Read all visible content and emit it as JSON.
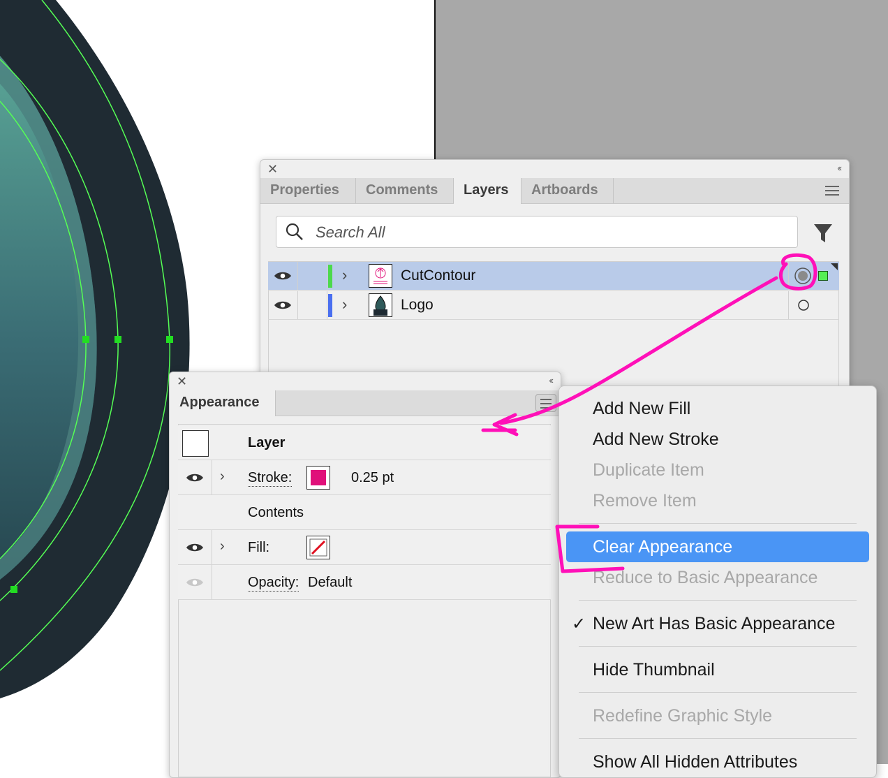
{
  "layers_panel": {
    "tabs": [
      {
        "label": "Properties"
      },
      {
        "label": "Comments"
      },
      {
        "label": "Layers"
      },
      {
        "label": "Artboards"
      }
    ],
    "close_glyph": "✕",
    "collapse_glyph": "‹‹",
    "search_placeholder": "Search All",
    "layers": [
      {
        "name": "CutContour",
        "selected": true,
        "color": "#4cd94c"
      },
      {
        "name": "Logo",
        "selected": false,
        "color": "#4a6ff0"
      }
    ]
  },
  "appearance_panel": {
    "tab": "Appearance",
    "close_glyph": "✕",
    "collapse_glyph": "‹‹",
    "rows": {
      "header": "Layer",
      "stroke_label": "Stroke:",
      "stroke_value": "0.25 pt",
      "contents": "Contents",
      "fill_label": "Fill:",
      "opacity_label": "Opacity:",
      "opacity_value": "Default"
    },
    "stroke_color": "#e0107a"
  },
  "context_menu": {
    "items": [
      {
        "label": "Add New Fill",
        "enabled": true
      },
      {
        "label": "Add New Stroke",
        "enabled": true
      },
      {
        "label": "Duplicate Item",
        "enabled": false
      },
      {
        "label": "Remove Item",
        "enabled": false
      },
      {
        "label": "Clear Appearance",
        "enabled": true,
        "highlighted": true
      },
      {
        "label": "Reduce to Basic Appearance",
        "enabled": false
      },
      {
        "label": "New Art Has Basic Appearance",
        "enabled": true,
        "checked": true
      },
      {
        "label": "Hide Thumbnail",
        "enabled": true
      },
      {
        "label": "Redefine Graphic Style",
        "enabled": false
      },
      {
        "label": "Show All Hidden Attributes",
        "enabled": true
      }
    ],
    "check_glyph": "✓"
  },
  "colors": {
    "annotation": "#ff10b8",
    "highlight": "#4a95f5",
    "selection": "#b9cbe9",
    "artwork_dark": "#1f2b33",
    "guide_green": "#55ff55"
  }
}
